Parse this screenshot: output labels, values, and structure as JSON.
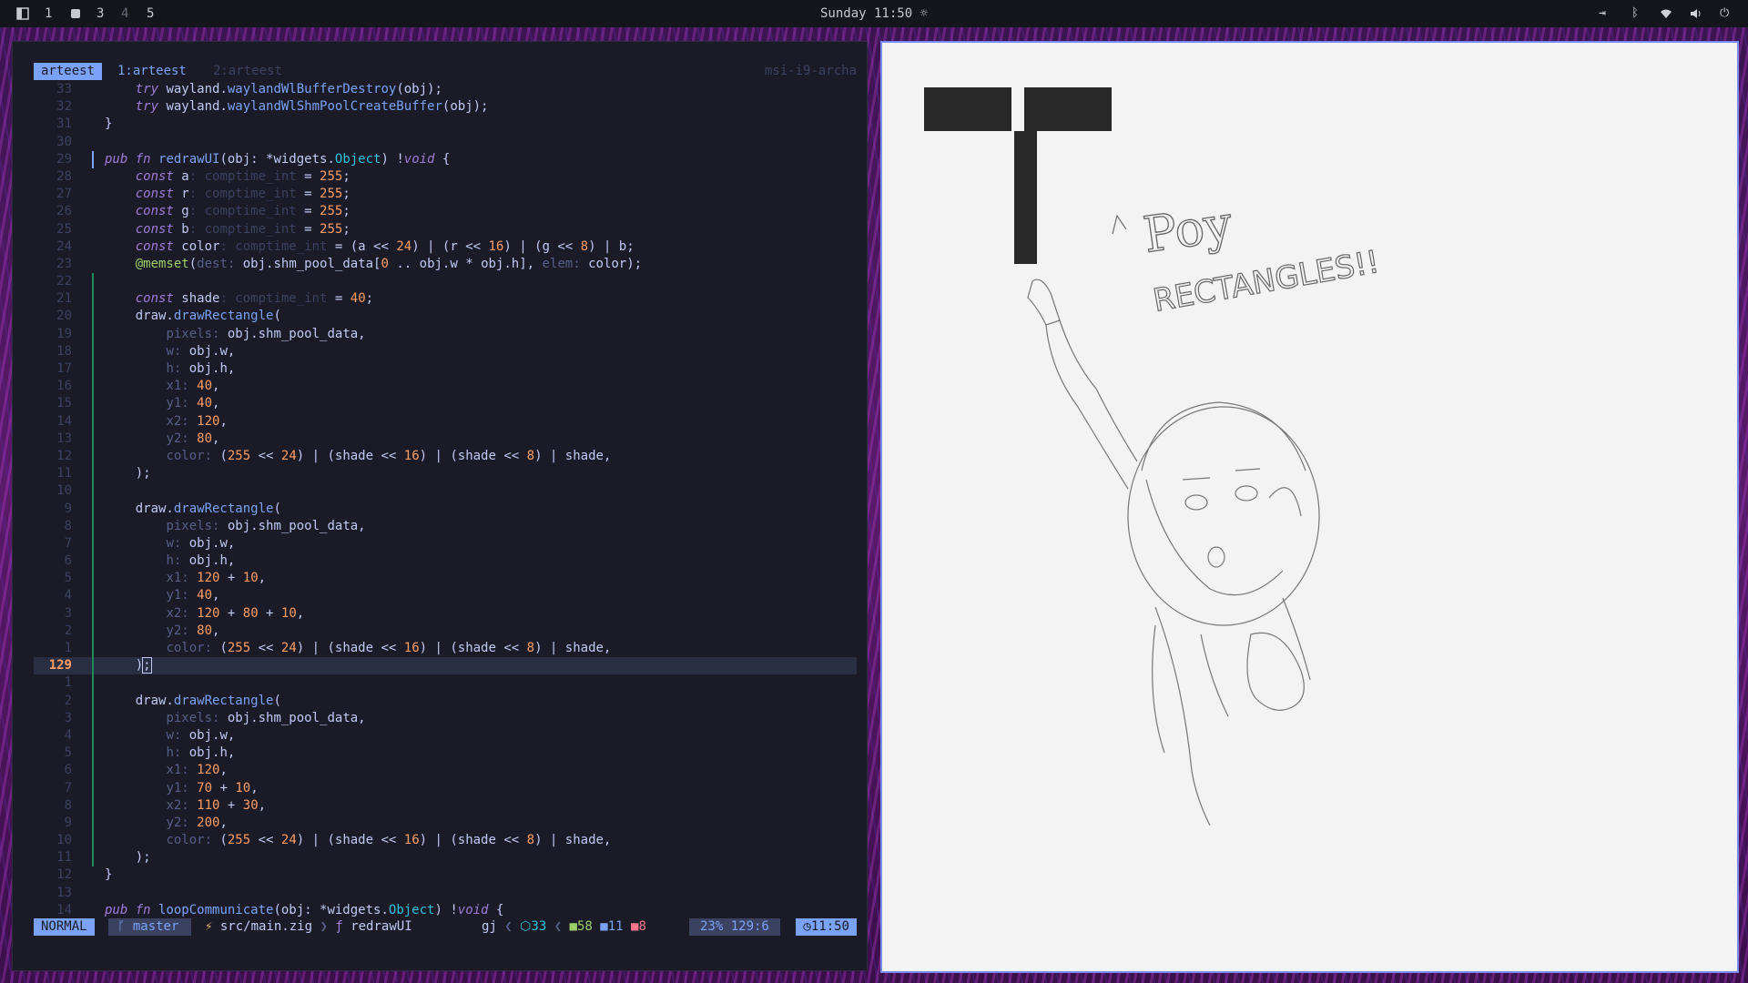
{
  "topbar": {
    "workspaces": [
      {
        "label": "1"
      },
      {
        "label": "3"
      },
      {
        "label": "4"
      },
      {
        "label": "5"
      }
    ],
    "clock": "Sunday 11:50"
  },
  "editor": {
    "tabs": {
      "active": "arteest",
      "buffer1": "1:arteest",
      "buffer2": "2:arteest",
      "host": "msi-i9-archa"
    },
    "status": {
      "mode": "NORMAL",
      "branch": "master",
      "file": "src/main.zig",
      "symbol": "redrawUI",
      "gj": "gj",
      "lsp": "33",
      "added": "58",
      "changed": "11",
      "removed": "8",
      "position": "23% 129:6",
      "time": "11:50"
    }
  },
  "canvas": {
    "text1": "Poy",
    "text2": "RECTANGLES!!"
  },
  "colors": {
    "accent": "#7aa2f7",
    "background": "#1a1b26",
    "keyword": "#9d7cd8",
    "number": "#ff9e64",
    "canvas_border": "#7a8cf0"
  }
}
